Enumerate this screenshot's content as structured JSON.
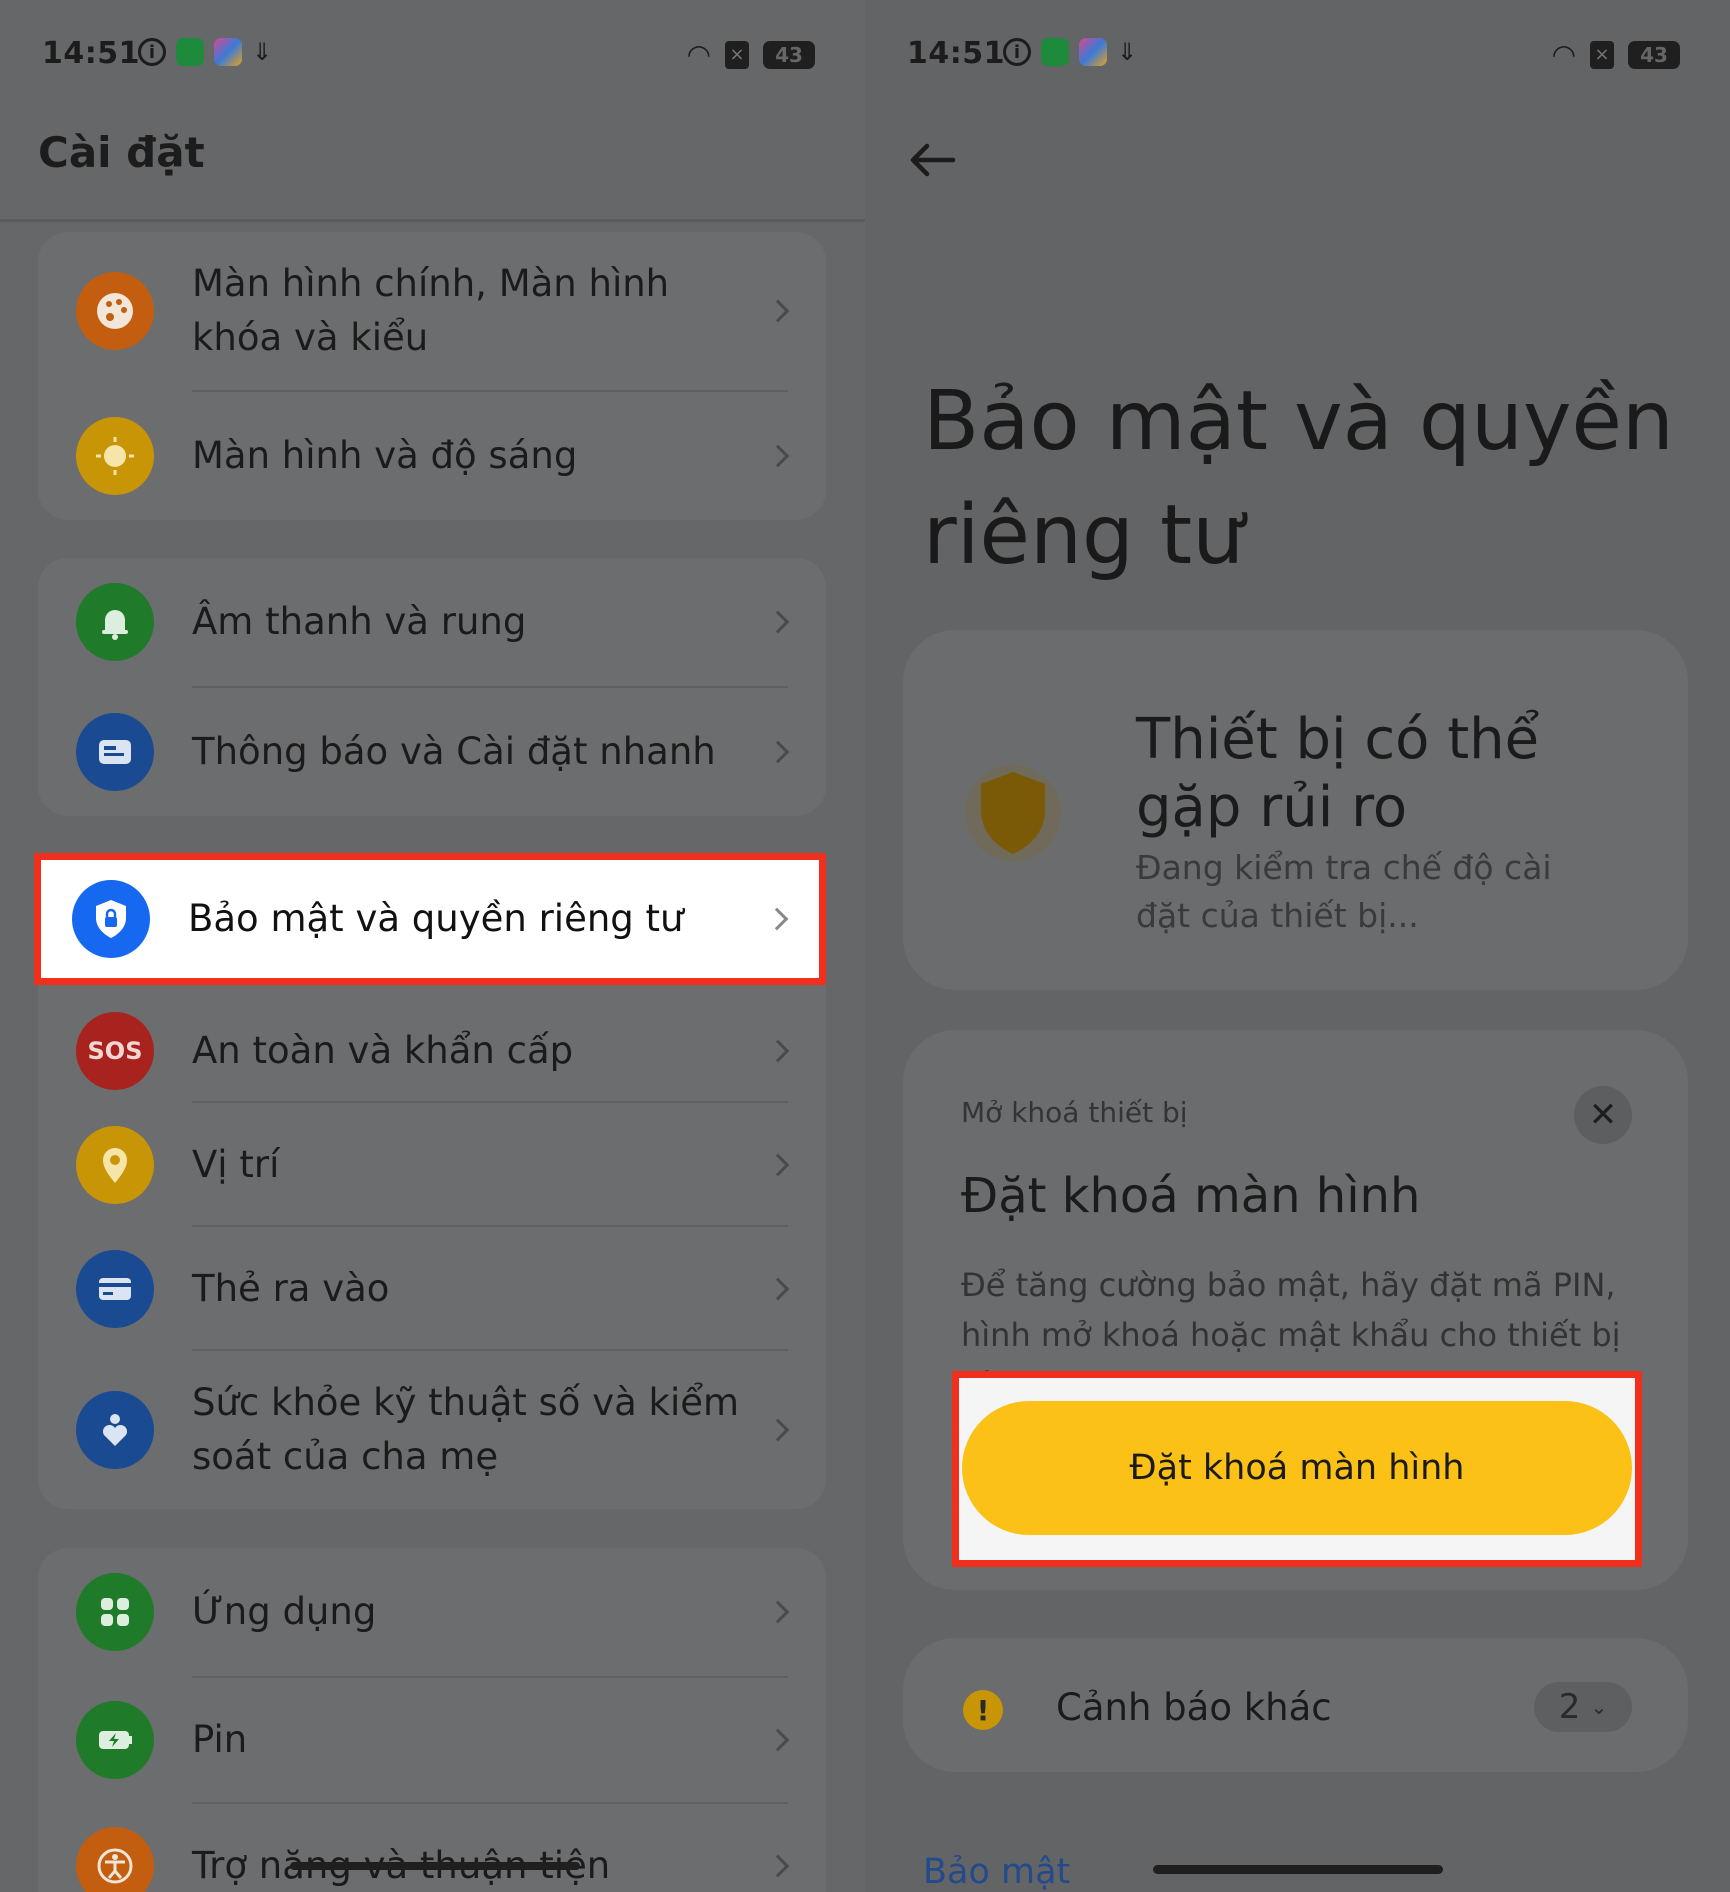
{
  "status": {
    "time": "14:51",
    "battery": "43"
  },
  "left": {
    "title": "Cài đặt",
    "groups": [
      [
        {
          "label": "Màn hình chính, Màn hình khóa và kiểu",
          "icon": "palette-icon",
          "color": "#c35d10"
        },
        {
          "label": "Màn hình và độ sáng",
          "icon": "sun-icon",
          "color": "#c79506"
        }
      ],
      [
        {
          "label": "Âm thanh và rung",
          "icon": "bell-icon",
          "color": "#1f7a2a"
        },
        {
          "label": "Thông báo và Cài đặt nhanh",
          "icon": "notification-icon",
          "color": "#1a4a92"
        }
      ],
      [
        {
          "label": "Bảo mật và quyền riêng tư",
          "icon": "shield-lock-icon",
          "color": "#1668f0"
        },
        {
          "label": "An toàn và khẩn cấp",
          "icon": "sos-icon",
          "color": "#a8231e",
          "badge": "SOS"
        },
        {
          "label": "Vị trí",
          "icon": "location-pin-icon",
          "color": "#c79506"
        },
        {
          "label": "Thẻ ra vào",
          "icon": "card-icon",
          "color": "#1a4a92"
        },
        {
          "label": "Sức khỏe kỹ thuật số và kiểm soát của cha mẹ",
          "icon": "heart-person-icon",
          "color": "#1a4a92"
        }
      ],
      [
        {
          "label": "Ứng dụng",
          "icon": "apps-grid-icon",
          "color": "#1f7a2a"
        },
        {
          "label": "Pin",
          "icon": "battery-icon",
          "color": "#1f7a2a"
        },
        {
          "label": "Trợ năng và thuận tiện",
          "icon": "accessibility-icon",
          "color": "#c35d10"
        }
      ]
    ]
  },
  "right": {
    "title": "Bảo mật và quyền riêng tư",
    "risk": {
      "title": "Thiết bị có thể gặp rủi ro",
      "subtitle": "Đang kiểm tra chế độ cài đặt của thiết bị..."
    },
    "lock": {
      "caption": "Mở khoá thiết bị",
      "title": "Đặt khoá màn hình",
      "description": "Để tăng cường bảo mật, hãy đặt mã PIN, hình mở khoá hoặc mật khẩu cho thiết bị này.",
      "button": "Đặt khoá màn hình"
    },
    "other_warnings": {
      "label": "Cảnh báo khác",
      "count": "2"
    },
    "section_link": "Bảo mật"
  }
}
